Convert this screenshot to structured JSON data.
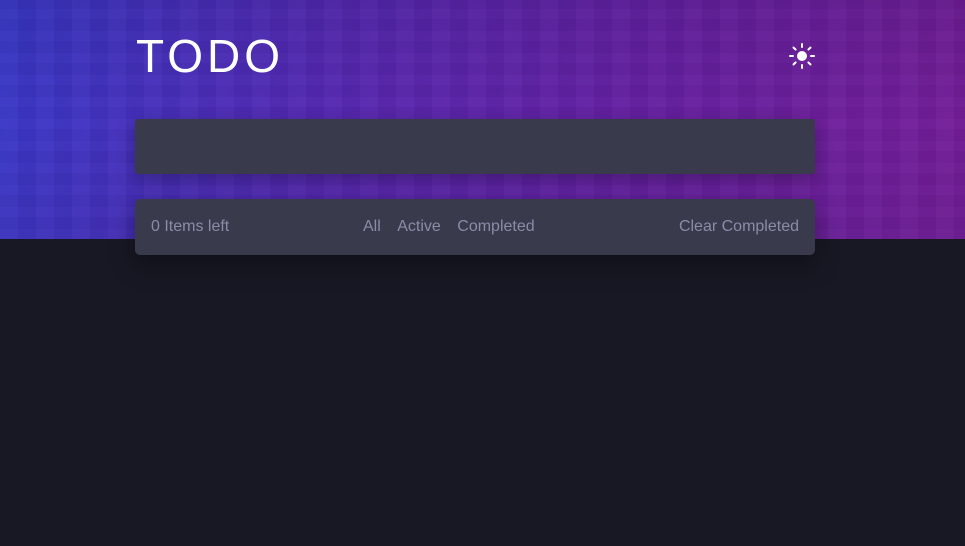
{
  "header": {
    "title": "TODO",
    "theme_icon": "sun-icon"
  },
  "new_todo": {
    "value": "",
    "placeholder": ""
  },
  "footer": {
    "items_left": "0 Items left",
    "filters": [
      {
        "label": "All",
        "active": false
      },
      {
        "label": "Active",
        "active": false
      },
      {
        "label": "Completed",
        "active": false
      }
    ],
    "clear_label": "Clear Completed"
  },
  "colors": {
    "background": "#181824",
    "panel": "#393a4b",
    "muted_text": "#8a8ca8",
    "title": "#ffffff",
    "hero_gradient_start": "#3a3bd0",
    "hero_gradient_end": "#7a1f9c"
  }
}
